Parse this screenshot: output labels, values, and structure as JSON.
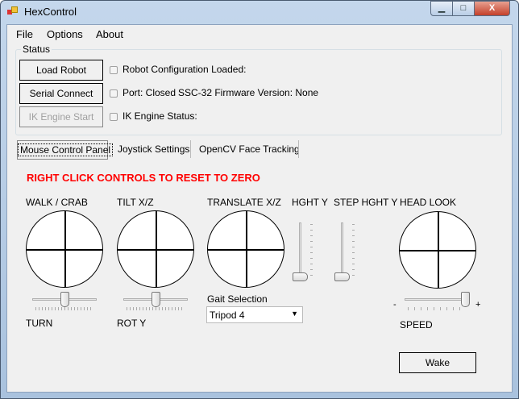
{
  "window": {
    "title": "HexControl",
    "minimize": "▁",
    "maximize": "□",
    "close": "X"
  },
  "menu": [
    "File",
    "Options",
    "About"
  ],
  "status": {
    "group_label": "Status",
    "load_robot": "Load Robot",
    "serial_connect": "Serial Connect",
    "ik_engine_start": "IK Engine Start",
    "robot_config": "Robot Configuration Loaded:",
    "port": "Port: Closed",
    "firmware": "SSC-32 Firmware Version: None",
    "ik_status": "IK Engine Status:"
  },
  "tabs": [
    "Mouse Control Panel",
    "Joystick Settings",
    "OpenCV Face Tracking"
  ],
  "panel": {
    "warning": "RIGHT CLICK CONTROLS TO RESET TO ZERO",
    "warning_color": "#ff0000",
    "walk": "WALK / CRAB",
    "tilt": "TILT X/Z",
    "translate": "TRANSLATE X/Z",
    "hght": "HGHT Y",
    "step_hght": "STEP HGHT Y",
    "head_look": "HEAD LOOK",
    "turn": "TURN",
    "rot_y": "ROT Y",
    "speed": "SPEED",
    "minus": "-",
    "plus": "+",
    "gait_label": "Gait Selection",
    "gait_value": "Tripod 4",
    "wake": "Wake"
  },
  "sliders": {
    "turn": 0.5,
    "rot_y": 0.5,
    "hght_y": 0,
    "step_hght_y": 0,
    "speed": 0.95
  }
}
